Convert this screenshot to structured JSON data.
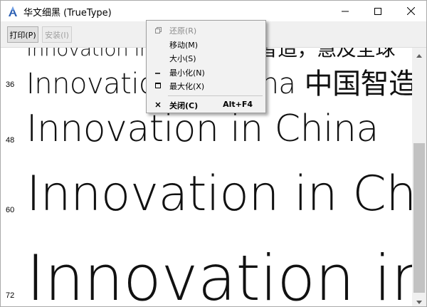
{
  "window": {
    "title": "华文细黑 (TrueType)",
    "controls": {
      "minimize": "minimize-icon",
      "maximize": "maximize-icon",
      "close": "close-icon"
    }
  },
  "toolbar": {
    "print_label": "打印(P)",
    "install_label": "安装(I)"
  },
  "preview": {
    "rows": [
      {
        "size": "",
        "sample": "Innovation in China 中国智造，慧及全球"
      },
      {
        "size": "36",
        "sample": "Innovation in China 中国智造"
      },
      {
        "size": "48",
        "sample": "Innovation in China"
      },
      {
        "size": "60",
        "sample": "Innovation in Ch"
      },
      {
        "size": "72",
        "sample": "Innovation in"
      }
    ]
  },
  "system_menu": {
    "restore": "还原(R)",
    "move": "移动(M)",
    "size": "大小(S)",
    "minimize": "最小化(N)",
    "maximize": "最大化(X)",
    "close": "关闭(C)",
    "close_shortcut": "Alt+F4"
  },
  "colors": {
    "menu_bg": "#f2f2f2",
    "toolbar_bg": "#f0f0f0",
    "scroll_thumb": "#c2c2c2",
    "disabled_text": "#8a8a8a"
  }
}
